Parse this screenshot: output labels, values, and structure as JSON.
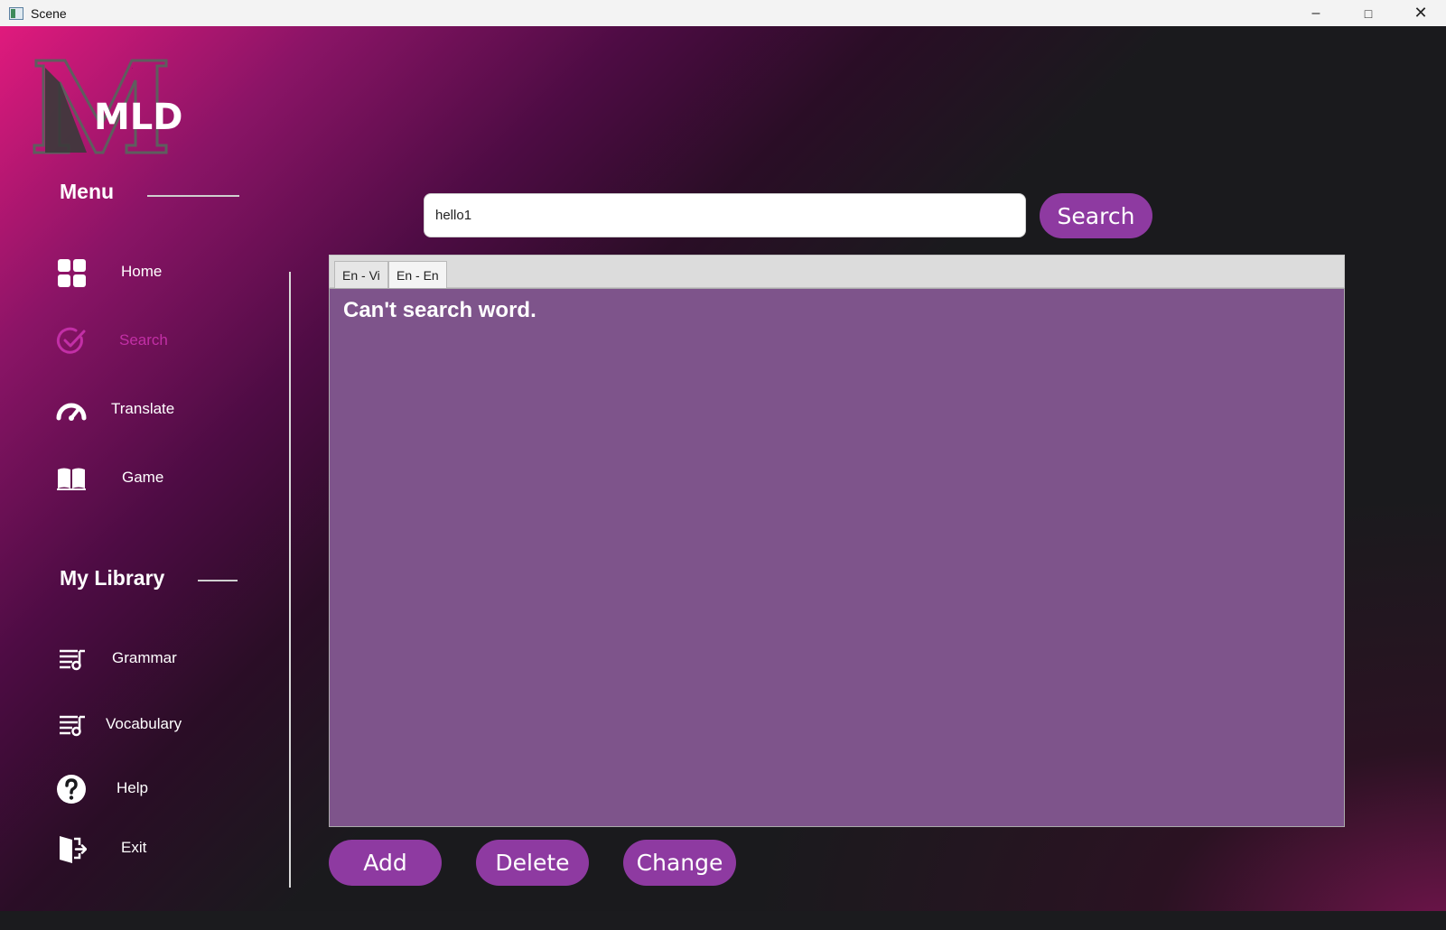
{
  "window": {
    "title": "Scene",
    "controls": [
      "minimize-icon",
      "maximize-icon",
      "close-icon"
    ]
  },
  "logo": {
    "text": "MLD",
    "monogram": "M"
  },
  "sidebar": {
    "menu_title": "Menu",
    "items": [
      {
        "label": "Home",
        "icon": "home-grid-icon"
      },
      {
        "label": "Search",
        "icon": "check-circle-icon",
        "active": true
      },
      {
        "label": "Translate",
        "icon": "speedometer-icon"
      },
      {
        "label": "Game",
        "icon": "open-book-icon"
      }
    ],
    "library_title": "My Library",
    "library_items": [
      {
        "label": "Grammar",
        "icon": "playlist-icon"
      },
      {
        "label": "Vocabulary",
        "icon": "playlist-icon"
      },
      {
        "label": "Help",
        "icon": "question-circle-icon"
      },
      {
        "label": "Exit",
        "icon": "exit-door-icon"
      }
    ]
  },
  "search": {
    "value": "hello1",
    "button_label": "Search"
  },
  "tabs": [
    {
      "label": "En - Vi"
    },
    {
      "label": "En - En",
      "selected": true
    }
  ],
  "result": {
    "message": "Can't search word."
  },
  "actions": {
    "add_label": "Add",
    "delete_label": "Delete",
    "change_label": "Change"
  },
  "colors": {
    "accent": "#8e3aa1",
    "active_nav": "#c22fa6",
    "result_bg": "#7e548b",
    "gradient_start": "#e01a7d",
    "background": "#1b1b1e"
  }
}
